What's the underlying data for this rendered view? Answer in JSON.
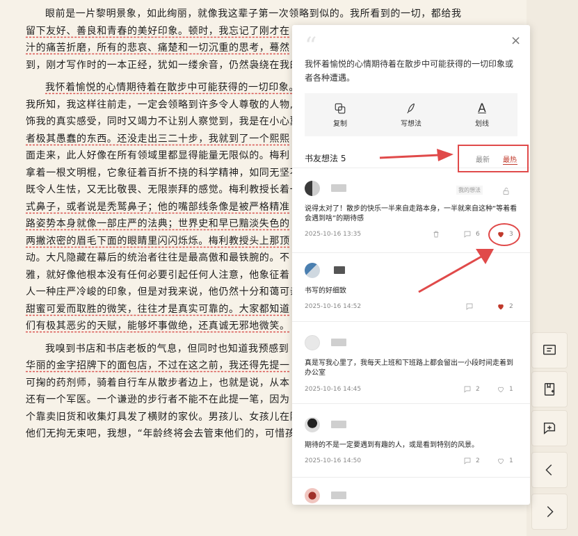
{
  "reader": {
    "p1": [
      "眼前是一片黎明景象，如此绚丽，就像我这辈子第一次领略到似的。我所看到的一切，都给我",
      "留下友好、善良和青春的美好印象。顿时，我忘记了刚才在",
      "汁的痛苦折磨，所有的悲哀、痛楚和一切沉重的思考，蓦然",
      "到，刚才写作时的一本正经，犹如一缕余音，仍然袅绕在我的"
    ],
    "p2": [
      "我怀着愉悦的心情期待着在散步中可能获得的一切印象。",
      "我所知，我这样往前走，一定会领略到许多令人尊敬的人物,",
      "饰我的真实感受，同时又竭力不让别人察觉到，我是在小心翼",
      "者极其愚蠢的东西。还没走出三二十步，我就到了一个熙熙",
      "面走来，此人好像在所有领域里都显得能量无限似的。梅利",
      "拿着一根文明棍，它象征着百折不挠的科学精神，如同无坚不",
      "既令人生怯，又无比敬畏、无限崇拜的感觉。梅利教授长着一",
      "式鼻子，或者说是秃鹫鼻子；他的嘴部线条像是被严格精准",
      "路姿势本身就像一部庄严的法典；世界史和早已黯淡失色的",
      "两撇浓密的眉毛下面的眼睛里闪闪烁烁。梅利教授头上那顶",
      "动。大凡隐藏在幕后的统治者往往是最高傲和最铁腕的。不",
      "雅，就好像他根本没有任何必要引起任何人注意，他象征着",
      "人一种庄严冷峻的印象，但是对我来说，他仍然十分和蔼可亲",
      "甜蜜可爱而取胜的微笑，往往才是真实可靠的。大家都知道",
      "们有极其恶劣的天赋，能够坏事做绝，还真诚无邪地微笑。"
    ],
    "p3": [
      "我嗅到书店和书店老板的气息，但同时也知道我预感到",
      "华丽的金字招牌下的面包店，不过在这之前，我还得先提一",
      "可掬的药剂师，骑着自行车从散步者边上，也就是说，从本",
      "还有一个军医。一个谦逊的步行者不能不在此提一笔，因为",
      "个靠卖旧货和收集灯具发了横财的家伙。男孩儿、女孩儿在阳光下无忧无虑地嬉戏打闹。我在",
      "他们无拘无束吧，我想，“年龄终将会去管束他们的，可惜孩子们总是太早地受到约束”。一条狗"
    ]
  },
  "panel": {
    "quote": "我怀着愉悦的心情期待着在散步中可能获得的一切印象或者各种遭遇。",
    "close_glyph": "×",
    "actions": {
      "copy": "复制",
      "write": "写想法",
      "underline": "划线",
      "underline_glyph": "A"
    },
    "thoughts_label": "书友想法 5",
    "sort_latest": "最新",
    "sort_hot": "最热",
    "comments": [
      {
        "tag": "我的想法",
        "text": "说得太对了！散步的快乐一半来自走路本身，一半就来自这种“等着看会遇到啥”的期待感",
        "time": "2025-10-16 13:35",
        "replies": "6",
        "likes": "3"
      },
      {
        "text": "书写的好细致",
        "time": "2025-10-16 14:52",
        "likes": "2"
      },
      {
        "text": "真是写我心里了，我每天上班和下班路上都会留出一小段时间走着到办公室",
        "time": "2025-10-16 14:45",
        "replies": "2",
        "likes": "1"
      },
      {
        "text": "期待的不是一定要遇到有趣的人，或是看到特别的风景。",
        "time": "2025-10-16 14:50",
        "replies": "2",
        "likes": "1"
      }
    ]
  },
  "colors": {
    "accent": "#c0392b",
    "annotation": "#e04a4a",
    "paper": "#f7f2e8"
  },
  "icons": [
    "copy-icon",
    "pen-icon",
    "underline-icon",
    "close-icon",
    "trash-icon",
    "comment-icon",
    "heart-icon",
    "lock-icon",
    "note-icon",
    "bookmark-icon",
    "add-note-icon",
    "chevron-left-icon",
    "chevron-right-icon"
  ]
}
